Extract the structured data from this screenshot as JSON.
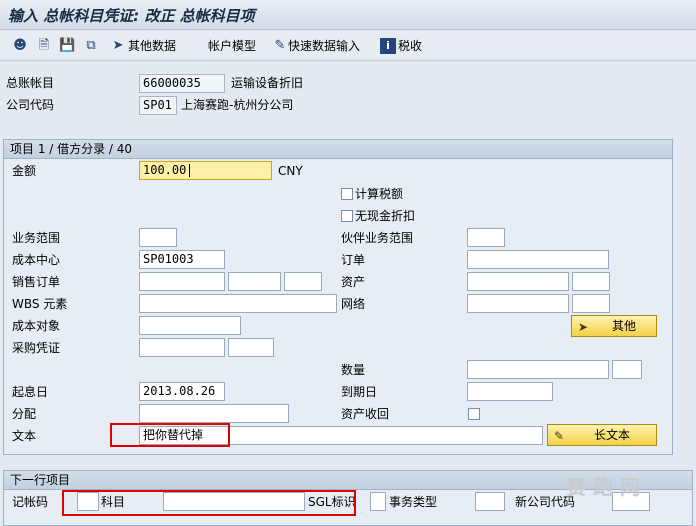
{
  "window": {
    "title": "输入 总帐科目凭证: 改正 总帐科目项"
  },
  "toolbar": {
    "items": [
      {
        "icon": "person-icon"
      },
      {
        "icon": "document-open-icon"
      },
      {
        "icon": "document-save-icon"
      },
      {
        "icon": "copy-icon"
      },
      {
        "label": "其他数据",
        "icon": "arrow-right-icon"
      },
      {
        "label": "帐户模型"
      },
      {
        "label": "快速数据输入",
        "icon": "pencil-icon"
      },
      {
        "label": "税收",
        "icon": "info-icon"
      }
    ]
  },
  "header": {
    "gl_account_label": "总账帐目",
    "gl_account_value": "66000035",
    "gl_account_desc": "运输设备折旧",
    "company_code_label": "公司代码",
    "company_code_value": "SP01",
    "company_code_desc": "上海赛跑-杭州分公司"
  },
  "item_group": {
    "title": "项目 1 / 借方分录 / 40",
    "amount_label": "金额",
    "amount_value": "100.00",
    "currency": "CNY",
    "calc_tax_label": "计算税额",
    "no_cash_discount_label": "无现金折扣",
    "business_area_label": "业务范围",
    "trading_partner_ba_label": "伙伴业务范围",
    "cost_center_label": "成本中心",
    "cost_center_value": "SP01003",
    "order_label": "订单",
    "sales_order_label": "销售订单",
    "asset_label": "资产",
    "wbs_label": "WBS 元素",
    "network_label": "网络",
    "cost_object_label": "成本对象",
    "other_button": "其他",
    "purchase_doc_label": "采购凭证",
    "quantity_label": "数量",
    "value_date_label": "起息日",
    "value_date_value": "2013.08.26",
    "due_date_label": "到期日",
    "assignment_label": "分配",
    "asset_retirement_label": "资产收回",
    "text_label": "文本",
    "text_value": "把你替代掉",
    "long_text_button": "长文本"
  },
  "next_item": {
    "title": "下一行项目",
    "posting_key_label": "记帐码",
    "account_label": "科目",
    "sgl_label": "SGL标识",
    "transaction_type_label": "事务类型",
    "new_company_label": "新公司代码"
  },
  "watermark": "赛 跑 网"
}
